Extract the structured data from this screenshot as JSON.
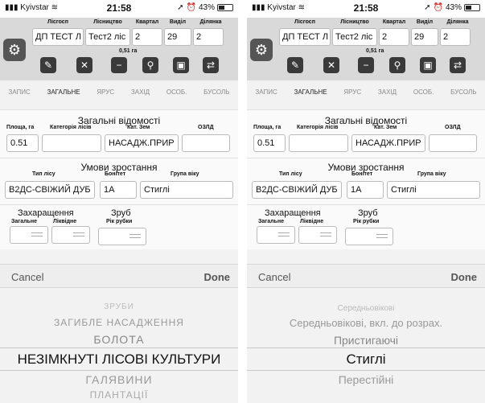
{
  "status": {
    "carrier": "Kyivstar",
    "time": "21:58",
    "battery": "43%",
    "battery_level": 0.43
  },
  "header": {
    "labels": [
      "Лісгосп",
      "Лісництво",
      "Квартал",
      "Виділ",
      "Ділянка"
    ],
    "values": [
      "ДП ТЕСТ Л",
      "Тест2 ліс",
      "2",
      "29",
      "2"
    ],
    "area": "0,51 га"
  },
  "toolbar": {
    "icons": [
      "edit-icon",
      "delete-icon",
      "minus-icon",
      "map-pin-icon",
      "save-icon",
      "sync-icon"
    ]
  },
  "tabs": [
    "ЗАПИС",
    "ЗАГАЛЬНЕ",
    "ЯРУС",
    "ЗАХІД",
    "ОСОБ.",
    "БУСОЛЬ"
  ],
  "general": {
    "title": "Загальні відомості",
    "labels": [
      "Площа, га",
      "Категорія лісів",
      "Кат. Зем",
      "ОЗЛД"
    ],
    "area_value": "0.51",
    "land_value": "НАСАДЖ.ПРИР"
  },
  "growth": {
    "title": "Умови зростання",
    "labels": [
      "Тип лісу",
      "Бонітет",
      "Група віку"
    ],
    "forest_type": "В2ДС-СВІЖИЙ ДУБ",
    "bonitet": "1А",
    "age_group": "Стиглі"
  },
  "clutter": {
    "title": "Захаращення",
    "labels": [
      "Загальне",
      "Ліквідне"
    ]
  },
  "cut": {
    "title": "Зруб",
    "label": "Рік рубки"
  },
  "picker": {
    "cancel": "Cancel",
    "done": "Done"
  },
  "left_wheel": {
    "options": [
      "ЗРУБИ",
      "ЗАГИБЛЕ НАСАДЖЕННЯ",
      "БОЛОТА",
      "НЕЗІМКНУТІ ЛІСОВІ КУЛЬТУРИ",
      "ГАЛЯВИНИ",
      "ПЛАНТАЦІЇ"
    ]
  },
  "right_wheel": {
    "options": [
      "Середньовікові",
      "Середньовікові, вкл. до розрах.",
      "Пристигаючі",
      "Стиглі",
      "Перестійні"
    ]
  }
}
